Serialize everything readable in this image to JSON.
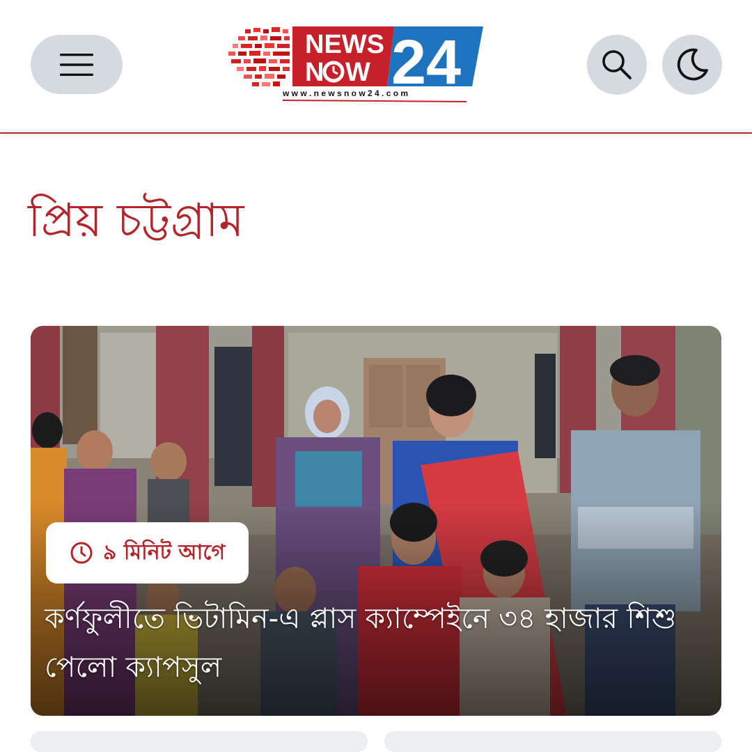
{
  "header": {
    "logo": {
      "word1": "NEWS",
      "word2_prefix": "N",
      "word2_suffix": "W",
      "number": "24",
      "url": "w w w . n e w s n o w 2 4 . c o m"
    },
    "menu_icon": "hamburger-icon",
    "search_icon": "search-icon",
    "theme_icon": "moon-icon"
  },
  "section": {
    "title": "প্রিয় চট্টগ্রাম"
  },
  "featured": {
    "time_ago": "৯ মিনিট আগে",
    "headline": "কর্ণফুলীতে ভিটামিন-এ প্লাস ক্যাম্পেইনে ৩৪ হাজার শিশু পেলো ক্যাপসুল",
    "image_alt": "group-photo"
  },
  "colors": {
    "brand_red": "#b3242b",
    "brand_blue": "#1e73be",
    "button_bg": "#d5d9e0"
  }
}
